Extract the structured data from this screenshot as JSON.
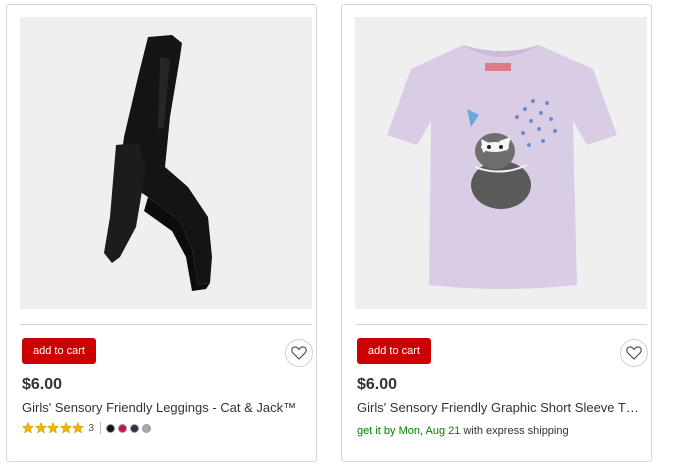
{
  "products": [
    {
      "add_to_cart_label": "add to cart",
      "price": "$6.00",
      "title": "Girls' Sensory Friendly Leggings - Cat & Jack™",
      "rating_stars": 5,
      "review_count": "3",
      "swatch_colors": [
        "#111111",
        "#c7154a",
        "#2b3446",
        "#a7a9ab"
      ]
    },
    {
      "add_to_cart_label": "add to cart",
      "price": "$6.00",
      "title": "Girls' Sensory Friendly Graphic Short Sleeve T…",
      "shipping_prefix": "get it by",
      "shipping_date": "Mon, Aug 21",
      "shipping_suffix": "with express shipping"
    }
  ],
  "icons": {
    "favorite": "heart-outline-icon",
    "star": "star-icon"
  },
  "colors": {
    "add_to_cart": "#cc0000",
    "star": "#f2b600",
    "shipping_green": "#008300"
  }
}
